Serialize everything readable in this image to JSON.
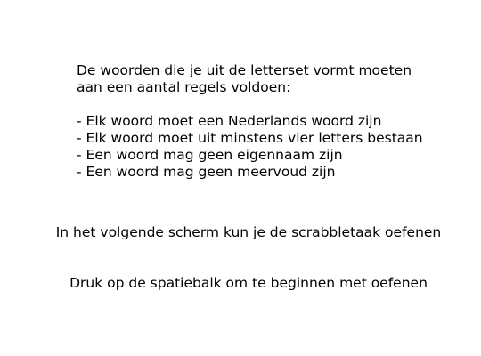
{
  "instructions": {
    "intro_lines": [
      "De woorden die je uit de letterset vormt moeten",
      "aan een aantal regels voldoen:"
    ],
    "rules": [
      "- Elk woord moet een Nederlands woord zijn",
      "- Elk woord moet uit minstens vier letters bestaan",
      "- Een woord mag geen eigennaam zijn",
      "- Een woord mag geen meervoud zijn"
    ]
  },
  "next_screen_text": "In het volgende scherm kun je de scrabbletaak oefenen",
  "press_space_text": "Druk op de spatiebalk om te beginnen met oefenen",
  "colors": {
    "background": "#ffffff",
    "text": "#000000"
  }
}
